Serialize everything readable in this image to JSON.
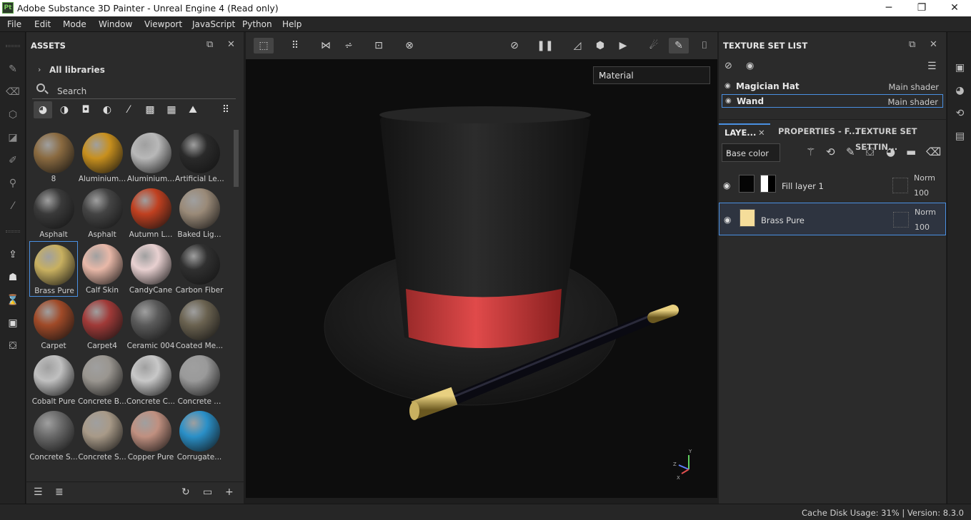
{
  "window": {
    "logo": "Pt",
    "title": "Adobe Substance 3D Painter - Unreal Engine 4 (Read only)",
    "buttons": [
      "─",
      "❐",
      "✕"
    ]
  },
  "menu": [
    "File",
    "Edit",
    "Mode",
    "Window",
    "Viewport",
    "JavaScript",
    "Python",
    "Help"
  ],
  "assets": {
    "title": "ASSETS",
    "library": "All libraries",
    "search_placeholder": "Search",
    "items": [
      {
        "label": "8",
        "color": "#8a6a40"
      },
      {
        "label": "Aluminium...",
        "color": "#c8901e"
      },
      {
        "label": "Aluminium...",
        "color": "#b8b8b8"
      },
      {
        "label": "Artificial Le...",
        "color": "#2a2a2a"
      },
      {
        "label": "Asphalt",
        "color": "#3a3a3a"
      },
      {
        "label": "Asphalt",
        "color": "#444444"
      },
      {
        "label": "Autumn L...",
        "color": "#c04020"
      },
      {
        "label": "Baked Lig...",
        "color": "#9a8a78"
      },
      {
        "label": "Brass Pure",
        "color": "#c8b060"
      },
      {
        "label": "Calf Skin",
        "color": "#e8b8a8"
      },
      {
        "label": "CandyCane",
        "color": "#e8d0d0"
      },
      {
        "label": "Carbon Fiber",
        "color": "#303030"
      },
      {
        "label": "Carpet",
        "color": "#a04a28"
      },
      {
        "label": "Carpet4",
        "color": "#a03a38"
      },
      {
        "label": "Ceramic 004",
        "color": "#5a5a5a"
      },
      {
        "label": "Coated Me...",
        "color": "#6a6250"
      },
      {
        "label": "Cobalt Pure",
        "color": "#c0c0c0"
      },
      {
        "label": "Concrete B...",
        "color": "#9a9690"
      },
      {
        "label": "Concrete C...",
        "color": "#c8c8c8"
      },
      {
        "label": "Concrete ...",
        "color": "#9a9a9a"
      },
      {
        "label": "Concrete S...",
        "color": "#6a6a6a"
      },
      {
        "label": "Concrete S...",
        "color": "#a89a88"
      },
      {
        "label": "Copper Pure",
        "color": "#c09080"
      },
      {
        "label": "Corrugate...",
        "color": "#2a90c8"
      }
    ]
  },
  "viewport": {
    "channel": "Material",
    "gizmo": {
      "x": "X",
      "y": "Y",
      "z": "Z"
    }
  },
  "texture_set_list": {
    "title": "TEXTURE SET LIST",
    "sets": [
      {
        "name": "Magician Hat",
        "shader": "Main shader"
      },
      {
        "name": "Wand",
        "shader": "Main shader"
      }
    ]
  },
  "layers": {
    "tabs": [
      "LAYE...",
      "PROPERTIES - F...",
      "TEXTURE SET SETTIN..."
    ],
    "channel": "Base color",
    "items": [
      {
        "name": "Fill layer 1",
        "mode": "Norm",
        "opacity": "100",
        "color": "#050505"
      },
      {
        "name": "Brass Pure",
        "mode": "Norm",
        "opacity": "100",
        "color": "#f5dd9a"
      }
    ]
  },
  "status": {
    "text": "Cache Disk Usage:   31% | Version: 8.3.0"
  }
}
